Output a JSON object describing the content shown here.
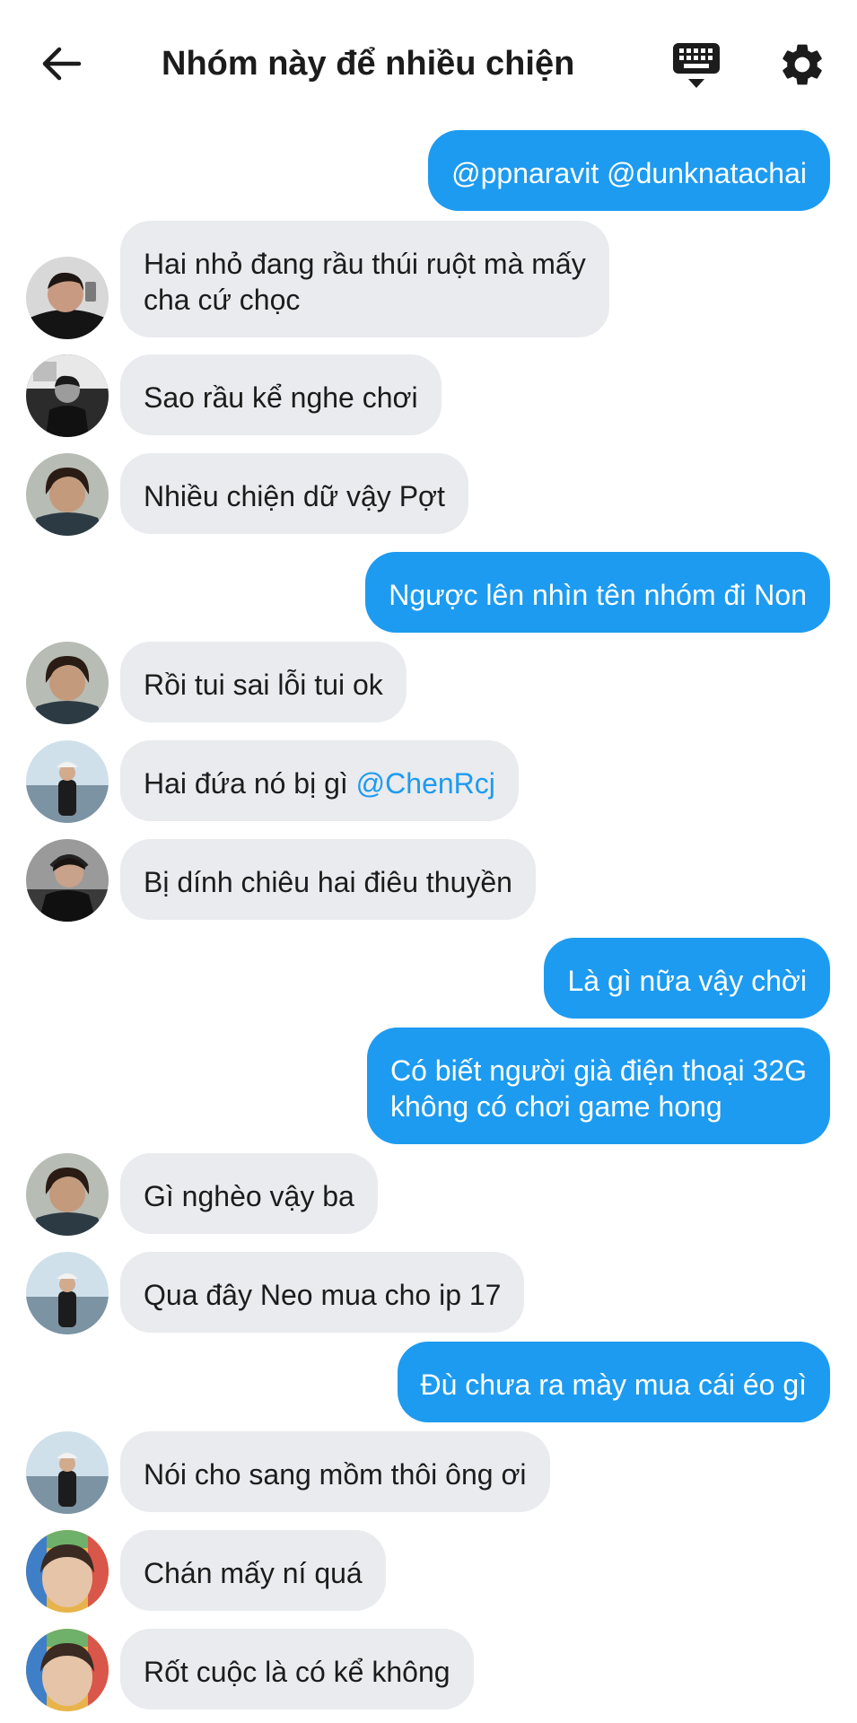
{
  "header": {
    "title": "Nhóm này để nhiều chiện"
  },
  "icons": {
    "back": "arrow-left-icon",
    "keyboard": "keyboard-icon",
    "settings": "gear-icon"
  },
  "colors": {
    "outgoing_bubble": "#1d9bf0",
    "incoming_bubble": "#e9ebee",
    "mention": "#1d9bf0"
  },
  "messages": [
    {
      "side": "out",
      "text": "@ppnaravit @dunknatachai"
    },
    {
      "side": "in",
      "lines": [
        "Hai nhỏ đang rầu thúi ruột mà mấy",
        "cha cứ chọc"
      ]
    },
    {
      "side": "in",
      "text": "Sao rầu kể nghe chơi"
    },
    {
      "side": "in",
      "text": "Nhiều chiện dữ vậy Pợt"
    },
    {
      "side": "out",
      "text": "Ngược lên nhìn tên nhóm đi Non"
    },
    {
      "side": "in",
      "text": "Rồi tui sai lỗi tui ok"
    },
    {
      "side": "in",
      "text": "Hai đứa nó bị gì ",
      "mention": "@ChenRcj"
    },
    {
      "side": "in",
      "text": "Bị dính chiêu hai điêu thuyền"
    },
    {
      "side": "out",
      "text": "Là gì nữa vậy chời"
    },
    {
      "side": "out",
      "lines": [
        "Có biết người già điện thoại 32G",
        "không có chơi game hong"
      ]
    },
    {
      "side": "in",
      "text": "Gì nghèo vậy ba"
    },
    {
      "side": "in",
      "text": "Qua đây Neo mua cho ip 17"
    },
    {
      "side": "out",
      "text": "Đù chưa ra mày mua cái éo gì"
    },
    {
      "side": "in",
      "text": "Nói cho sang mồm thôi ông ơi"
    },
    {
      "side": "in",
      "text": "Chán mấy ní quá"
    },
    {
      "side": "in",
      "text": "Rốt cuộc là có kể không"
    }
  ]
}
